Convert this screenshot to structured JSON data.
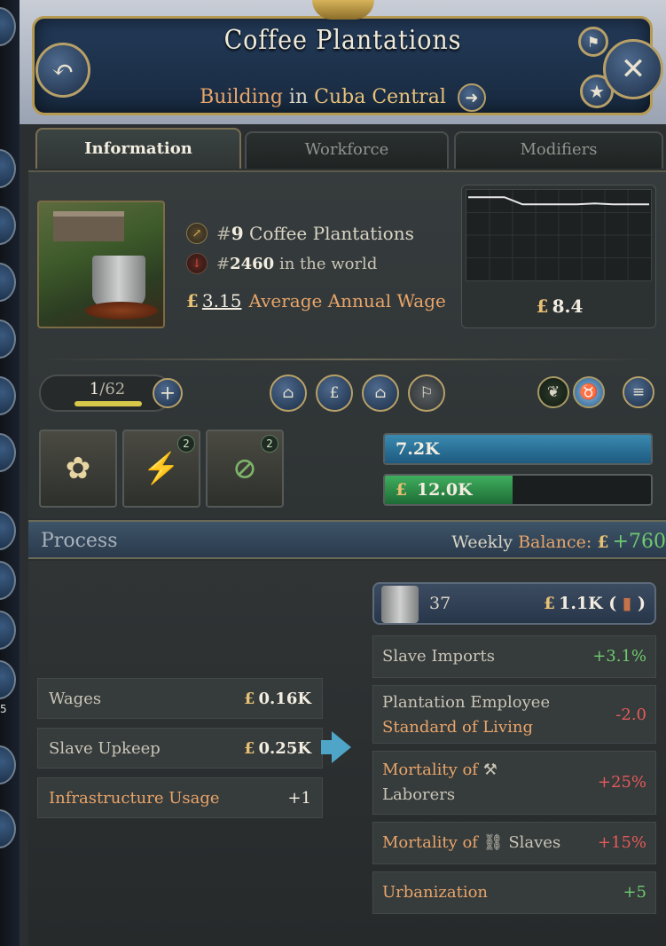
{
  "header": {
    "title": "Coffee Plantations",
    "subtitle_kind": "Building",
    "subtitle_mid": "in",
    "subtitle_place": "Cuba Central"
  },
  "tabs": [
    {
      "label": "Information",
      "active": true
    },
    {
      "label": "Workforce",
      "active": false
    },
    {
      "label": "Modifiers",
      "active": false
    }
  ],
  "info": {
    "rank_hash": "#",
    "rank_num": "9",
    "rank_label": "Coffee Plantations",
    "world_hash": "#",
    "world_num": "2460",
    "world_label": "in the world",
    "wage_currency": "£",
    "wage_value": "3.15",
    "wage_label": "Average Annual Wage"
  },
  "chart_data": {
    "type": "line",
    "x": [
      0,
      1,
      2,
      3,
      4,
      5,
      6,
      7,
      8,
      9,
      10
    ],
    "series": [
      {
        "values": [
          9.2,
          9.2,
          9.2,
          8.4,
          8.4,
          8.4,
          8.4,
          8.5,
          8.4,
          8.4,
          8.4
        ]
      }
    ],
    "value_currency": "£",
    "value_label": "8.4",
    "ylim": [
      0,
      10
    ]
  },
  "level": {
    "current": "1",
    "separator": "/",
    "max": "62",
    "fill_fraction": 0.95
  },
  "icons": {
    "back": "undo-arrow-icon",
    "close": "close-icon",
    "pin": "signpost-icon",
    "star": "star-icon",
    "go_to": "arrow-right-icon",
    "rank": "arrow-up-right-icon",
    "world": "arrow-down-icon"
  },
  "actions": [
    "expand-building-icon",
    "subsidize-icon",
    "downsize-building-icon",
    "flag-icon"
  ],
  "resources": [
    "seedling-icon",
    "cattle-icon"
  ],
  "mod_tiles": [
    {
      "name": "crop-rows-icon",
      "badge": ""
    },
    {
      "name": "whip-workers-icon",
      "badge": "2"
    },
    {
      "name": "no-railway-icon",
      "badge": "2"
    }
  ],
  "bars": [
    {
      "label": "7.2K",
      "fill_fraction": 1.0
    },
    {
      "currency": "£",
      "label": "12.0K",
      "fill_fraction": 0.48
    }
  ],
  "process": {
    "title": "Process",
    "balance_prefix": "Weekly",
    "balance_label": "Balance:",
    "balance_currency": "£",
    "balance_value": "+760"
  },
  "inputs": [
    {
      "label": "Wages",
      "currency": "£",
      "value": "0.16K",
      "orange": false
    },
    {
      "label": "Slave Upkeep",
      "currency": "£",
      "value": "0.25K",
      "orange": false
    },
    {
      "label": "Infrastructure Usage",
      "currency": "",
      "value": "+1",
      "orange": true
    }
  ],
  "output": {
    "count": "37",
    "currency": "£",
    "price": "1.1K (",
    "price_close": ")"
  },
  "outputs": [
    {
      "line1": "Slave Imports",
      "line2": "",
      "line2_orange": false,
      "orange": false,
      "value": "+3.1%",
      "positive": true
    },
    {
      "line1": "Plantation Employee",
      "line2": "Standard of Living",
      "line2_orange": true,
      "orange": false,
      "value": "-2.0",
      "positive": false
    },
    {
      "line1": "Mortality of",
      "line2": "Laborers",
      "line2_orange": false,
      "orange": true,
      "value": "+25%",
      "positive": false
    },
    {
      "line1": "Mortality of",
      "line1_suffix": "Slaves",
      "line2": "",
      "orange": true,
      "value": "+15%",
      "positive": false
    },
    {
      "line1": "Urbanization",
      "line2": "",
      "orange": true,
      "value": "+5",
      "positive": true
    }
  ],
  "sidebar": {
    "badge": "5"
  },
  "colors": {
    "accent": "#e8a56a",
    "positive": "#6fca6f",
    "negative": "#e65a5a",
    "gold": "#e6c074"
  }
}
